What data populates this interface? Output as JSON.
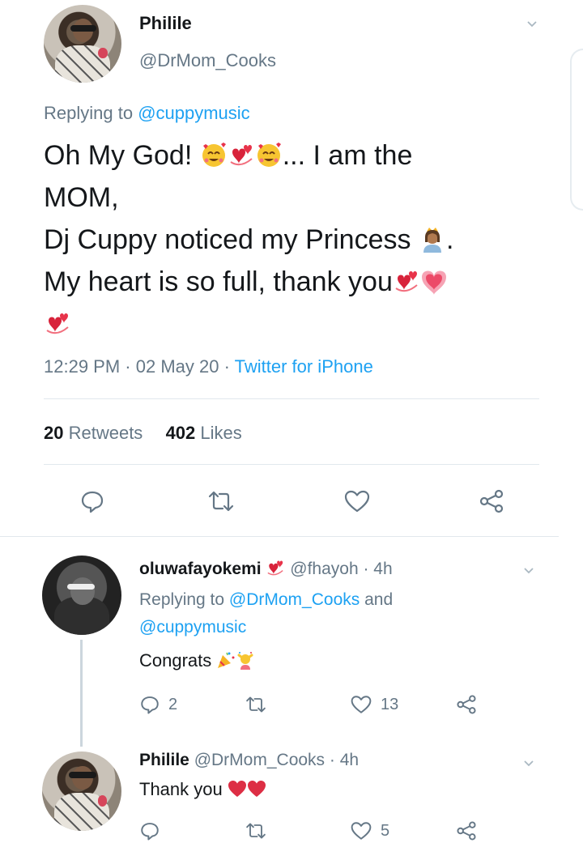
{
  "main_tweet": {
    "author_name": "Philile",
    "author_handle": "@DrMom_Cooks",
    "replying_prefix": "Replying to ",
    "replying_to": "@cuppymusic",
    "line1": "Oh My God! ",
    "line1_suffix": "... I am the",
    "line2": "MOM,",
    "line3": "Dj Cuppy noticed my Princess ",
    "line3_suffix": ".",
    "line4": "My heart is so full, thank you",
    "time": "12:29 PM",
    "date": "02 May 20",
    "source": "Twitter for iPhone",
    "retweets_count": "20",
    "retweets_label": " Retweets",
    "likes_count": "402",
    "likes_label": " Likes",
    "icons": [
      "reply-icon",
      "retweet-icon",
      "like-icon",
      "share-icon"
    ]
  },
  "reply1": {
    "author_name": "oluwafayokemi",
    "author_handle": "@fhayoh",
    "age": "4h",
    "replying_prefix": "Replying to ",
    "replying_to_1": "@DrMom_Cooks",
    "replying_and": " and",
    "replying_to_2": "@cuppymusic",
    "text": "Congrats ",
    "reply_count": "2",
    "like_count": "13"
  },
  "reply2": {
    "author_name": "Philile",
    "author_handle": "@DrMom_Cooks",
    "age": "4h",
    "text": "Thank you ",
    "like_count": "5"
  },
  "colors": {
    "accent": "#1da1f2",
    "secondary_text": "#657786",
    "divider": "#e1e8ed"
  }
}
